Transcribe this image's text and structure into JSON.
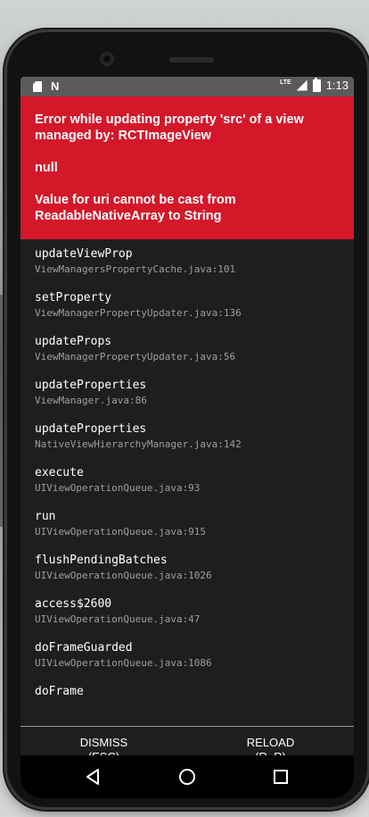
{
  "status_bar": {
    "network": "LTE",
    "time": "1:13"
  },
  "error": {
    "title": "Error while updating property 'src' of a view managed by: RCTImageView",
    "value": "null",
    "message": "Value for uri cannot be cast from ReadableNativeArray to String"
  },
  "stack": [
    {
      "method": "updateViewProp",
      "file": "ViewManagersPropertyCache.java:101"
    },
    {
      "method": "setProperty",
      "file": "ViewManagerPropertyUpdater.java:136"
    },
    {
      "method": "updateProps",
      "file": "ViewManagerPropertyUpdater.java:56"
    },
    {
      "method": "updateProperties",
      "file": "ViewManager.java:86"
    },
    {
      "method": "updateProperties",
      "file": "NativeViewHierarchyManager.java:142"
    },
    {
      "method": "execute",
      "file": "UIViewOperationQueue.java:93"
    },
    {
      "method": "run",
      "file": "UIViewOperationQueue.java:915"
    },
    {
      "method": "flushPendingBatches",
      "file": "UIViewOperationQueue.java:1026"
    },
    {
      "method": "access$2600",
      "file": "UIViewOperationQueue.java:47"
    },
    {
      "method": "doFrameGuarded",
      "file": "UIViewOperationQueue.java:1086"
    },
    {
      "method": "doFrame",
      "file": ""
    }
  ],
  "actions": {
    "dismiss": "DISMISS\n(ESC)",
    "reload": "RELOAD\n(R, R)"
  },
  "icons": {
    "status_left": [
      "sd-card-icon",
      "n-notification-icon"
    ],
    "status_right": [
      "lte-signal-icon",
      "battery-icon"
    ],
    "nav": [
      "back-icon",
      "home-icon",
      "recents-icon"
    ]
  }
}
